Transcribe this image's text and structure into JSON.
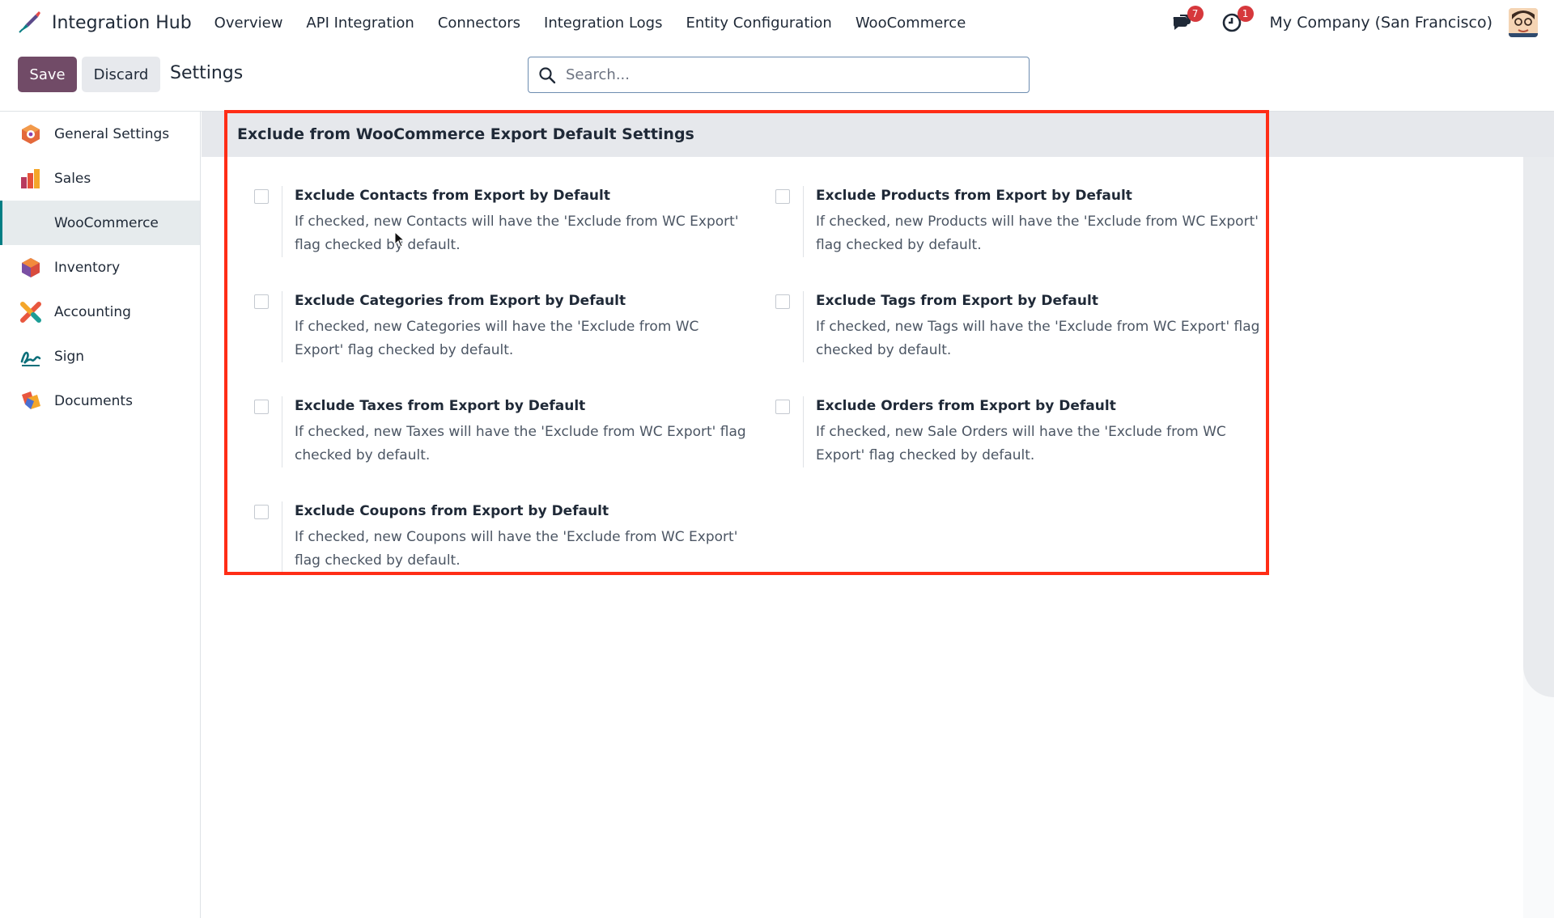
{
  "app": {
    "name": "Integration Hub",
    "menu": [
      "Overview",
      "API Integration",
      "Connectors",
      "Integration Logs",
      "Entity Configuration",
      "WooCommerce"
    ],
    "messages_count": "7",
    "activities_count": "1",
    "company": "My Company (San Francisco)"
  },
  "control_panel": {
    "save_label": "Save",
    "discard_label": "Discard",
    "title": "Settings",
    "search_placeholder": "Search..."
  },
  "sidebar": {
    "items": [
      {
        "label": "General Settings",
        "icon": "general-settings-icon"
      },
      {
        "label": "Sales",
        "icon": "sales-icon"
      },
      {
        "label": "WooCommerce",
        "icon": "",
        "active": true
      },
      {
        "label": "Inventory",
        "icon": "inventory-icon"
      },
      {
        "label": "Accounting",
        "icon": "accounting-icon"
      },
      {
        "label": "Sign",
        "icon": "sign-icon"
      },
      {
        "label": "Documents",
        "icon": "documents-icon"
      }
    ]
  },
  "section": {
    "title": "Exclude from WooCommerce Export Default Settings",
    "settings": [
      {
        "title": "Exclude Contacts from Export by Default",
        "description": "If checked, new Contacts will have the 'Exclude from WC Export' flag checked by default.",
        "checked": false
      },
      {
        "title": "Exclude Products from Export by Default",
        "description": "If checked, new Products will have the 'Exclude from WC Export' flag checked by default.",
        "checked": false
      },
      {
        "title": "Exclude Categories from Export by Default",
        "description": "If checked, new Categories will have the 'Exclude from WC Export' flag checked by default.",
        "checked": false
      },
      {
        "title": "Exclude Tags from Export by Default",
        "description": "If checked, new Tags will have the 'Exclude from WC Export' flag checked by default.",
        "checked": false
      },
      {
        "title": "Exclude Taxes from Export by Default",
        "description": "If checked, new Taxes will have the 'Exclude from WC Export' flag checked by default.",
        "checked": false
      },
      {
        "title": "Exclude Orders from Export by Default",
        "description": "If checked, new Sale Orders will have the 'Exclude from WC Export' flag checked by default.",
        "checked": false
      },
      {
        "title": "Exclude Coupons from Export by Default",
        "description": "If checked, new Coupons will have the 'Exclude from WC Export' flag checked by default.",
        "checked": false
      }
    ]
  },
  "colors": {
    "primary": "#714b67",
    "highlight_border": "#ff2d16",
    "badge": "#d6383c",
    "active_accent": "#017e84"
  }
}
